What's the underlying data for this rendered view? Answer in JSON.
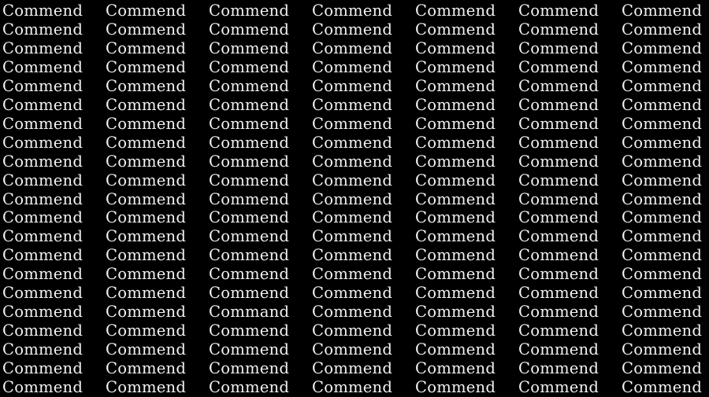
{
  "puzzle": {
    "base_word": "Commend",
    "odd_word": "Command",
    "rows": 21,
    "columns": 7,
    "odd_position": {
      "row": 17,
      "column": 3
    },
    "background_color": "#000000",
    "text_color": "#f2f2f2",
    "grid": [
      [
        "Commend",
        "Commend",
        "Commend",
        "Commend",
        "Commend",
        "Commend",
        "Commend"
      ],
      [
        "Commend",
        "Commend",
        "Commend",
        "Commend",
        "Commend",
        "Commend",
        "Commend"
      ],
      [
        "Commend",
        "Commend",
        "Commend",
        "Commend",
        "Commend",
        "Commend",
        "Commend"
      ],
      [
        "Commend",
        "Commend",
        "Commend",
        "Commend",
        "Commend",
        "Commend",
        "Commend"
      ],
      [
        "Commend",
        "Commend",
        "Commend",
        "Commend",
        "Commend",
        "Commend",
        "Commend"
      ],
      [
        "Commend",
        "Commend",
        "Commend",
        "Commend",
        "Commend",
        "Commend",
        "Commend"
      ],
      [
        "Commend",
        "Commend",
        "Commend",
        "Commend",
        "Commend",
        "Commend",
        "Commend"
      ],
      [
        "Commend",
        "Commend",
        "Commend",
        "Commend",
        "Commend",
        "Commend",
        "Commend"
      ],
      [
        "Commend",
        "Commend",
        "Commend",
        "Commend",
        "Commend",
        "Commend",
        "Commend"
      ],
      [
        "Commend",
        "Commend",
        "Commend",
        "Commend",
        "Commend",
        "Commend",
        "Commend"
      ],
      [
        "Commend",
        "Commend",
        "Commend",
        "Commend",
        "Commend",
        "Commend",
        "Commend"
      ],
      [
        "Commend",
        "Commend",
        "Commend",
        "Commend",
        "Commend",
        "Commend",
        "Commend"
      ],
      [
        "Commend",
        "Commend",
        "Commend",
        "Commend",
        "Commend",
        "Commend",
        "Commend"
      ],
      [
        "Commend",
        "Commend",
        "Commend",
        "Commend",
        "Commend",
        "Commend",
        "Commend"
      ],
      [
        "Commend",
        "Commend",
        "Commend",
        "Commend",
        "Commend",
        "Commend",
        "Commend"
      ],
      [
        "Commend",
        "Commend",
        "Commend",
        "Commend",
        "Commend",
        "Commend",
        "Commend"
      ],
      [
        "Commend",
        "Commend",
        "Command",
        "Commend",
        "Commend",
        "Commend",
        "Commend"
      ],
      [
        "Commend",
        "Commend",
        "Commend",
        "Commend",
        "Commend",
        "Commend",
        "Commend"
      ],
      [
        "Commend",
        "Commend",
        "Commend",
        "Commend",
        "Commend",
        "Commend",
        "Commend"
      ],
      [
        "Commend",
        "Commend",
        "Commend",
        "Commend",
        "Commend",
        "Commend",
        "Commend"
      ],
      [
        "Commend",
        "Commend",
        "Commend",
        "Commend",
        "Commend",
        "Commend",
        "Commend"
      ]
    ]
  }
}
